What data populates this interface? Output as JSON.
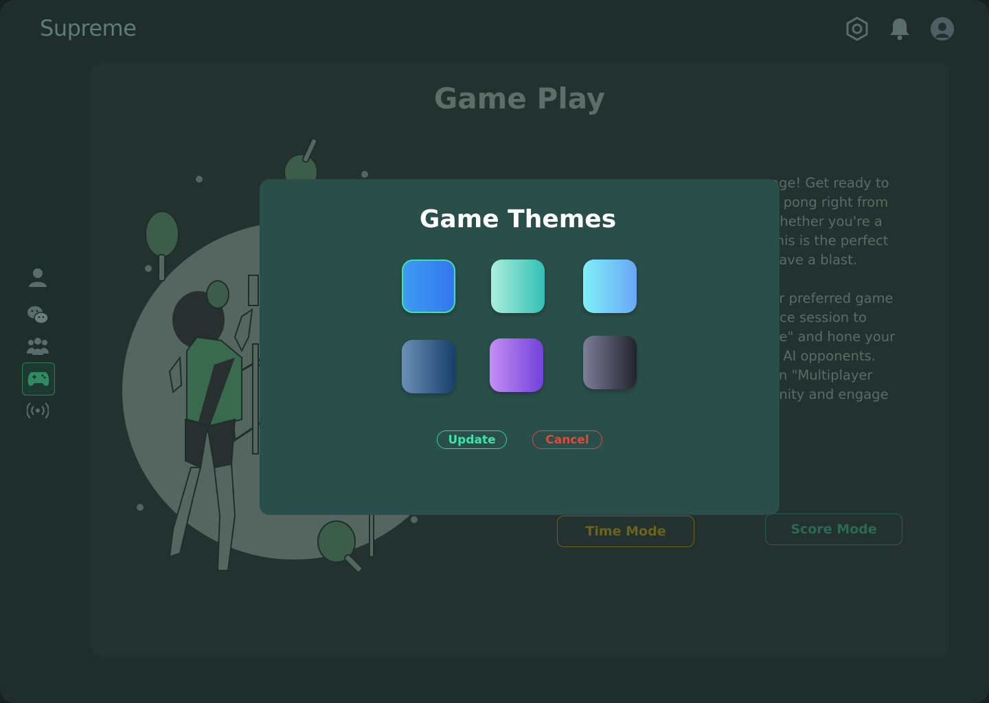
{
  "app": {
    "brand": "Supreme"
  },
  "topbar": {
    "icons": [
      "settings-icon",
      "bell-icon",
      "avatar-icon"
    ]
  },
  "sidebar": {
    "items": [
      {
        "icon": "user-icon",
        "active": false
      },
      {
        "icon": "chat-icon",
        "active": false
      },
      {
        "icon": "group-icon",
        "active": false
      },
      {
        "icon": "gamepad-icon",
        "active": true
      },
      {
        "icon": "broadcast-icon",
        "active": false
      }
    ]
  },
  "page": {
    "title": "Game Play",
    "description_visible": "age! Get ready to\ng pong right from\nVhether you're a\nthis is the perfect\nhave a blast.\n\nur preferred game\ntice session to\nde\" and hone your\ne AI opponents.\non \"Multiplayer\nunity and engage",
    "time_mode_label": "Time Mode",
    "score_mode_label": "Score Mode"
  },
  "modal": {
    "title": "Game Themes",
    "themes": [
      {
        "name": "blue",
        "from": "#3e9cf2",
        "to": "#3376ee",
        "selected": true
      },
      {
        "name": "mint",
        "from": "#aaeedd",
        "to": "#33c0b4",
        "selected": false
      },
      {
        "name": "sky",
        "from": "#7ff0f8",
        "to": "#6aa6f7",
        "selected": false
      },
      {
        "name": "navy",
        "from": "#6b8fb6",
        "to": "#173f6a",
        "selected": false
      },
      {
        "name": "violet",
        "from": "#c48ff5",
        "to": "#7242db",
        "selected": false
      },
      {
        "name": "slate",
        "from": "#7e7d99",
        "to": "#23232e",
        "selected": false
      }
    ],
    "update_label": "Update",
    "cancel_label": "Cancel"
  },
  "colors": {
    "accent_green": "#3de4a7",
    "danger_red": "#e2493a",
    "modal_bg": "#2a4e49"
  }
}
